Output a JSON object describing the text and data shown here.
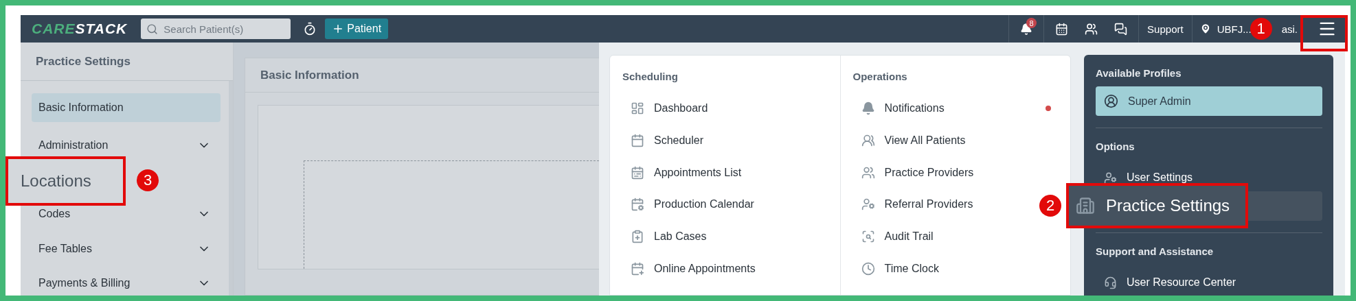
{
  "top_bar": {
    "logo": [
      {
        "text": "CARE",
        "color": "#4caf7d"
      },
      {
        "text": "STACK",
        "color": "#ffffff"
      }
    ],
    "search": {
      "placeholder": "Search Patient(s)"
    },
    "add_button": "Patient",
    "notification_count": "8",
    "support": "Support",
    "location": "UBFJ...",
    "user": "asi.",
    "menu_button": {
      "callout": "1"
    }
  },
  "sidebar": {
    "title": "Practice Settings",
    "items": [
      {
        "label": "Basic Information",
        "selected": true,
        "expandable": false,
        "zoomed": false
      },
      {
        "label": "Administration",
        "selected": false,
        "expandable": true,
        "zoomed": false
      },
      {
        "label": "Locations",
        "selected": false,
        "expandable": false,
        "zoomed": true,
        "callout": "3"
      },
      {
        "label": "Codes",
        "selected": false,
        "expandable": true,
        "zoomed": false
      },
      {
        "label": "Fee Tables",
        "selected": false,
        "expandable": true,
        "zoomed": false
      },
      {
        "label": "Payments & Billing",
        "selected": false,
        "expandable": true,
        "zoomed": false
      }
    ]
  },
  "main": {
    "card_title": "Basic Information"
  },
  "menu": {
    "columns": [
      {
        "title": "Scheduling",
        "items": [
          {
            "label": "Dashboard",
            "unread": false
          },
          {
            "label": "Scheduler",
            "unread": false
          },
          {
            "label": "Appointments List",
            "unread": false
          },
          {
            "label": "Production Calendar",
            "unread": false
          },
          {
            "label": "Lab Cases",
            "unread": false
          },
          {
            "label": "Online Appointments",
            "unread": false
          }
        ]
      },
      {
        "title": "Operations",
        "items": [
          {
            "label": "Notifications",
            "unread": true
          },
          {
            "label": "View All Patients",
            "unread": false
          },
          {
            "label": "Practice Providers",
            "unread": false
          },
          {
            "label": "Referral Providers",
            "unread": false
          },
          {
            "label": "Audit Trail",
            "unread": false
          },
          {
            "label": "Time Clock",
            "unread": false
          }
        ]
      }
    ]
  },
  "profile_panel": {
    "sections": [
      {
        "title": "Available Profiles",
        "items": [
          {
            "label": "Super Admin",
            "kind": "profile",
            "selected": true
          }
        ]
      },
      {
        "title": "Options",
        "items": [
          {
            "label": "User Settings",
            "kind": "option",
            "zoomed": false
          },
          {
            "label": "Practice Settings",
            "kind": "option",
            "zoomed": true,
            "callout": "2"
          }
        ]
      },
      {
        "title": "Support and Assistance",
        "items": [
          {
            "label": "User Resource Center",
            "kind": "option",
            "zoomed": false
          }
        ]
      }
    ]
  }
}
